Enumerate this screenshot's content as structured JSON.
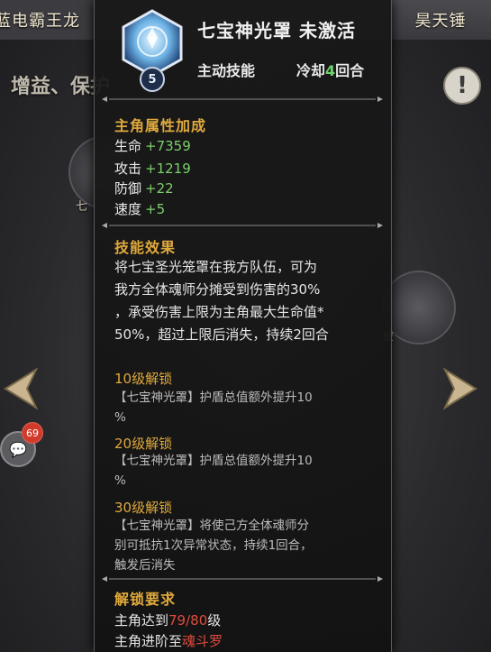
{
  "background": {
    "tab_left": "蓝电霸王龙",
    "tab_right": "昊天锤",
    "title": "增益、保护",
    "chat_badge_count": "69",
    "skill_label_left": "七",
    "skill_label_right": "被"
  },
  "skill": {
    "name": "七宝神光罩",
    "status": "未激活",
    "level": "5",
    "type": "主动技能",
    "cooldown_prefix": "冷却",
    "cooldown_value": "4",
    "cooldown_suffix": "回合"
  },
  "attributes": {
    "title": "主角属性加成",
    "items": [
      {
        "label": "生命",
        "value": "+7359"
      },
      {
        "label": "攻击",
        "value": "+1219"
      },
      {
        "label": "防御",
        "value": "+22"
      },
      {
        "label": "速度",
        "value": "+5"
      }
    ]
  },
  "effect": {
    "title": "技能效果",
    "lines": [
      "将七宝圣光笼罩在我方队伍，可为",
      "我方全体魂师分摊受到伤害的30%",
      "，承受伤害上限为主角最大生命值*",
      "50%，超过上限后消失，持续2回合"
    ]
  },
  "unlocks": [
    {
      "title": "10级解锁",
      "lines": [
        "【七宝神光罩】护盾总值额外提升10",
        "%"
      ]
    },
    {
      "title": "20级解锁",
      "lines": [
        "【七宝神光罩】护盾总值额外提升10",
        "%"
      ]
    },
    {
      "title": "30级解锁",
      "lines": [
        "【七宝神光罩】将使己方全体魂师分",
        "别可抵抗1次异常状态，持续1回合，",
        "触发后消失"
      ]
    }
  ],
  "requirements": {
    "title": "解锁要求",
    "level_prefix": "主角达到",
    "level_current": "79",
    "level_sep": "/",
    "level_required": "80",
    "level_suffix": "级",
    "rank_prefix": "主角进阶至",
    "rank_value": "魂斗罗"
  },
  "colors": {
    "accent_gold": "#e0a93c",
    "positive_green": "#7bd06a",
    "warning_red": "#e04a3d"
  }
}
